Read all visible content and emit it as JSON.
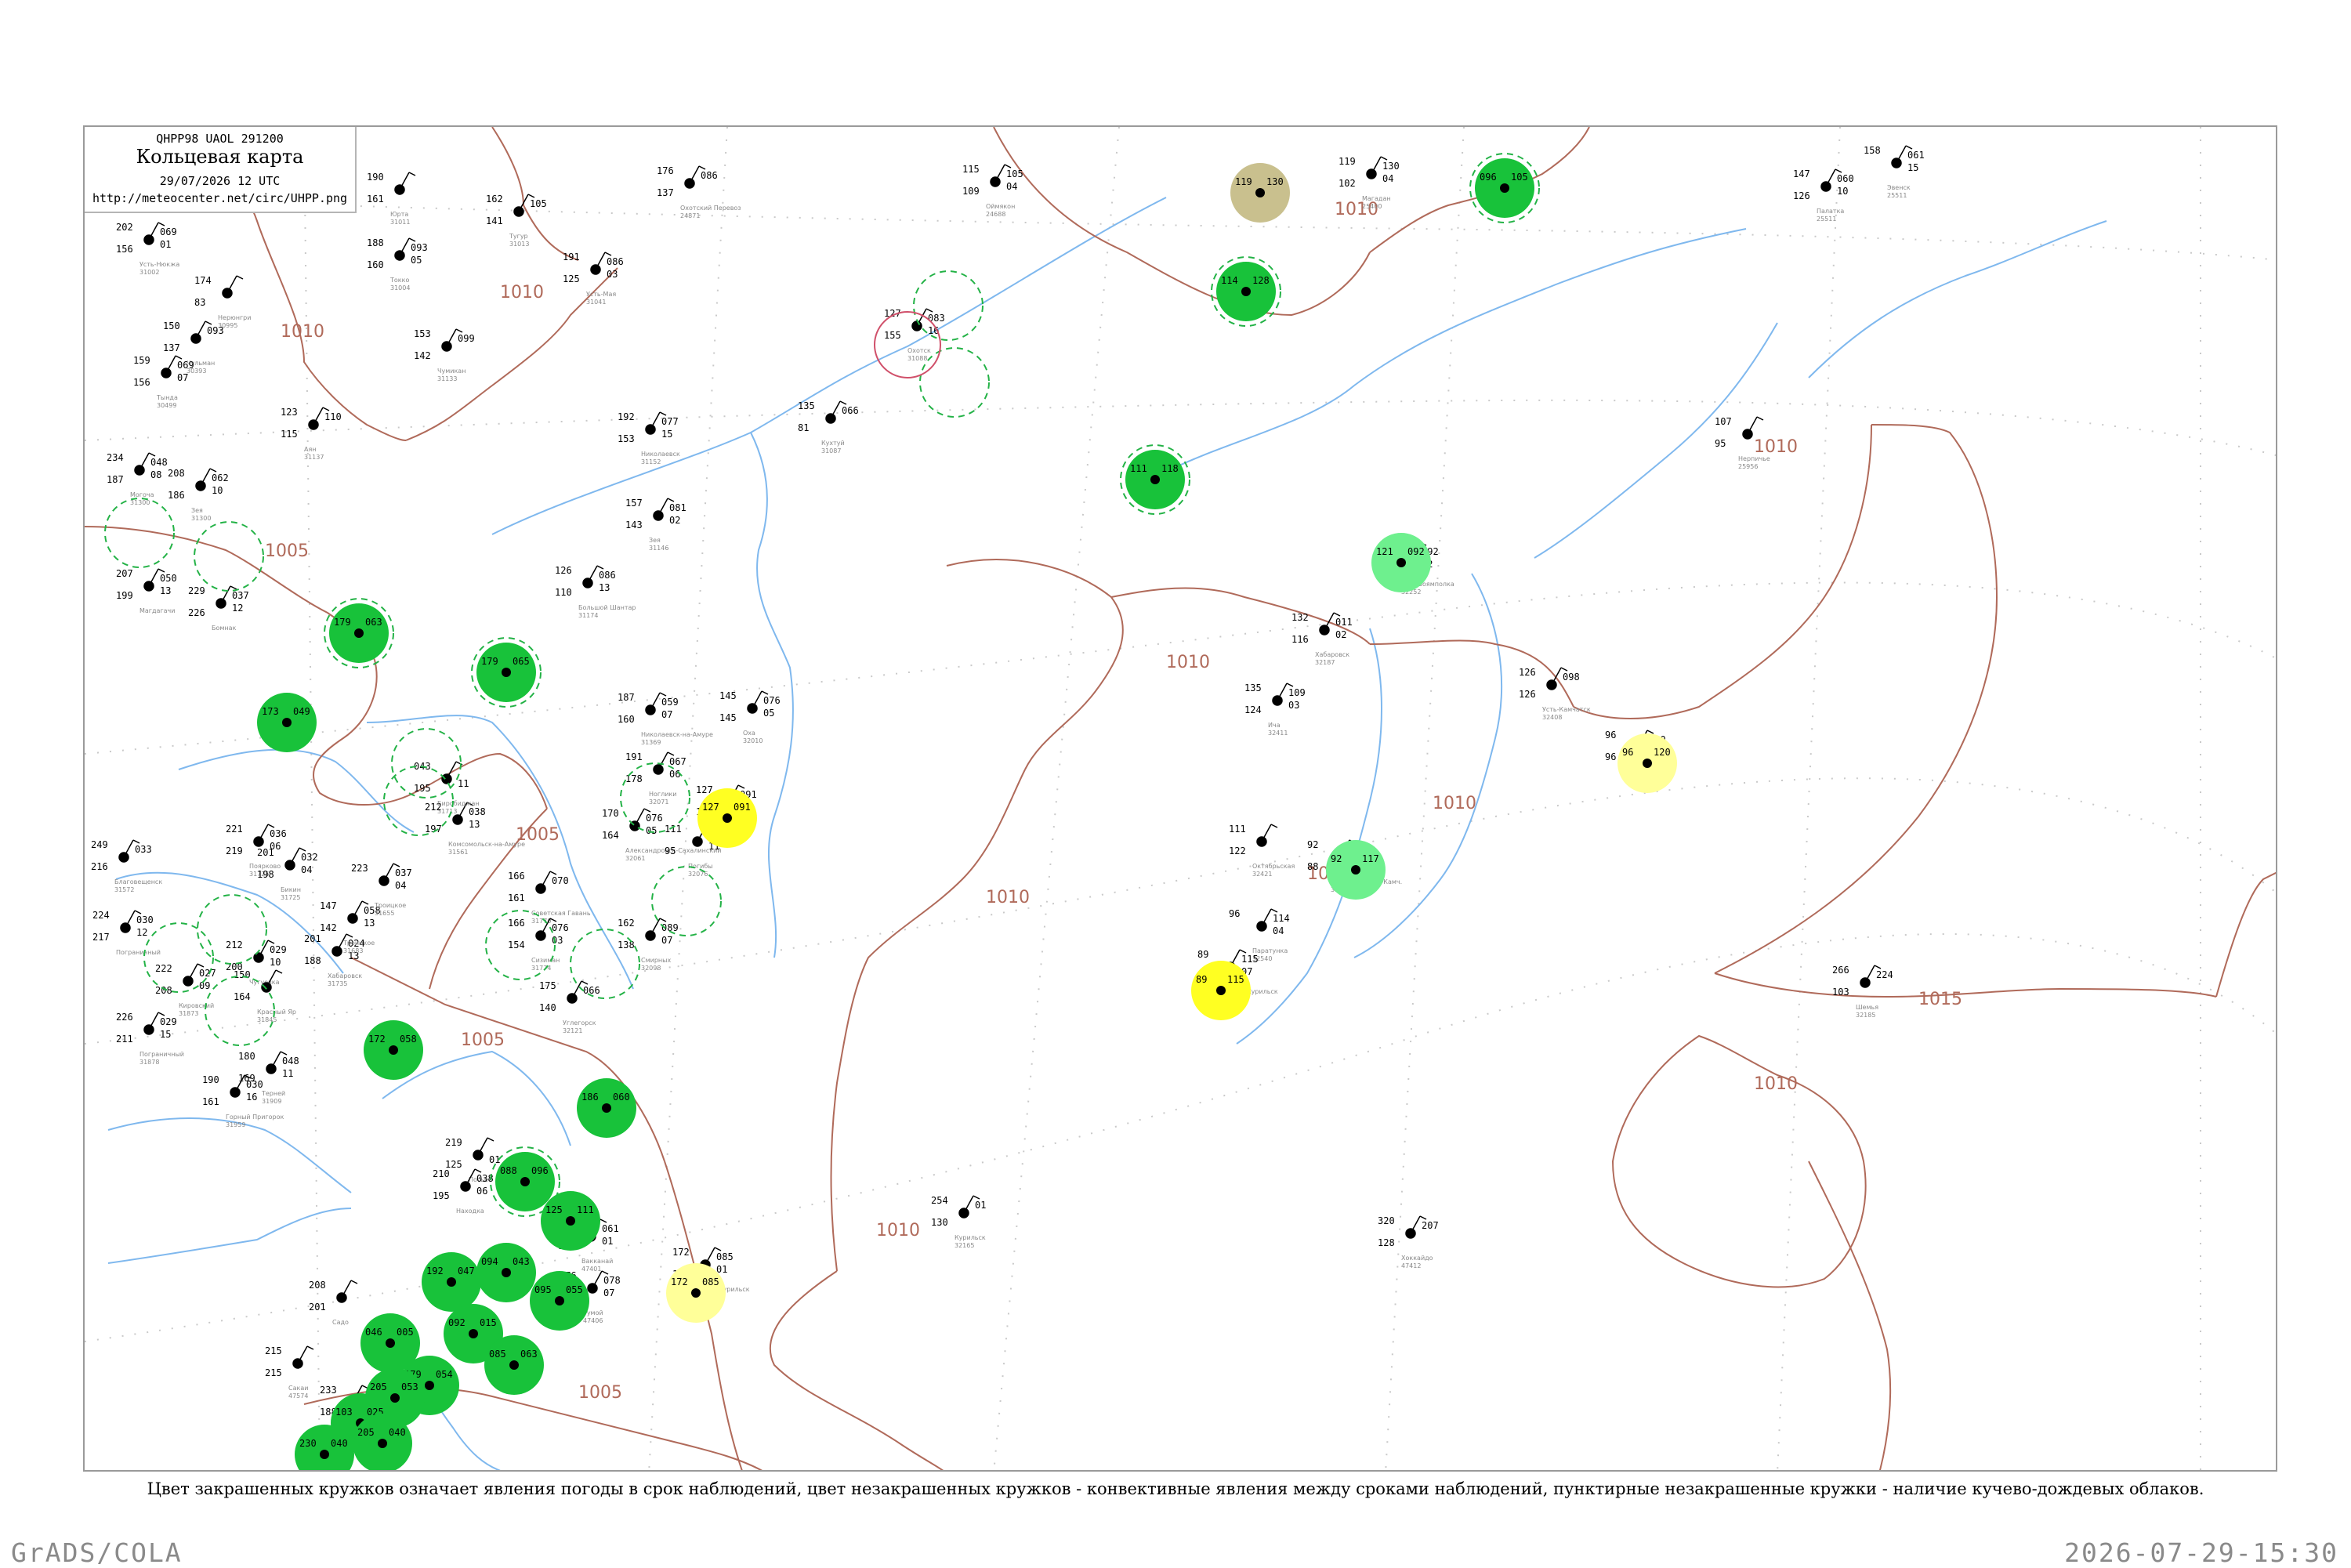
{
  "header": {
    "code": "QHPP98  UAOL  291200",
    "title": "Кольцевая карта",
    "time": "29/07/2026 12 UTC",
    "url": "http://meteocenter.net/circ/UHPP.png"
  },
  "caption": "Цвет закрашенных кружков означает явления погоды в срок наблюдений, цвет незакрашенных кружков - конвективные явления между сроками наблюдений, пунктирные незакрашенные кружки - наличие кучево-дождевых облаков.",
  "footer": {
    "left": "GrADS/COLA",
    "right": "2026-07-29-15:30"
  },
  "colors": {
    "isobar": "#b06a5a",
    "river": "#7fb8ee",
    "grid": "#c9c9c9",
    "green_fill": "#18c23a",
    "light_green_fill": "#6ef08e",
    "yellow_fill": "#ffff22",
    "pale_yellow_fill": "#ffff99",
    "olive_fill": "#c9c08e",
    "dashed_ring": "#23b246",
    "red_ring": "#d0506a"
  },
  "isobar_labels": [
    "1010",
    "1010",
    "1005",
    "1005",
    "1010",
    "1010",
    "1010",
    "1010",
    "1010",
    "1010",
    "1010",
    "1015",
    "1010",
    "1005",
    "1005"
  ],
  "stations": [
    {
      "id": "s1",
      "t": "202",
      "p": "156",
      "d": "069",
      "sub": "01",
      "name": "Усть-Нюкжа",
      "idx": "31002",
      "marker": "dot"
    },
    {
      "id": "s2",
      "t": "190",
      "p": "161",
      "d": "",
      "sub": "",
      "name": "Юрта",
      "idx": "31011",
      "marker": "dot"
    },
    {
      "id": "s3",
      "t": "162",
      "p": "141",
      "d": "105",
      "sub": "",
      "name": "Тугур",
      "idx": "31013",
      "marker": "dot"
    },
    {
      "id": "s4",
      "t": "174",
      "p": "83",
      "d": "",
      "sub": "",
      "name": "Нерюнгри",
      "idx": "30995",
      "marker": "dot"
    },
    {
      "id": "s5",
      "t": "150",
      "p": "137",
      "d": "093",
      "sub": "",
      "name": "Чульман",
      "idx": "30393",
      "marker": "dot"
    },
    {
      "id": "s6",
      "t": "159",
      "p": "156",
      "d": "069",
      "sub": "07",
      "name": "Тында",
      "idx": "30499",
      "marker": "dot"
    },
    {
      "id": "s7",
      "t": "188",
      "p": "160",
      "d": "093",
      "sub": "05",
      "name": "Токко",
      "idx": "31004",
      "marker": "dot"
    },
    {
      "id": "s8",
      "t": "191",
      "p": "125",
      "d": "086",
      "sub": "03",
      "name": "Усть-Мая",
      "idx": "31041",
      "marker": "dot"
    },
    {
      "id": "s9",
      "t": "176",
      "p": "137",
      "d": "086",
      "sub": "",
      "name": "Охотский Перевоз",
      "idx": "24871",
      "marker": "dot"
    },
    {
      "id": "s10",
      "t": "115",
      "p": "109",
      "d": "105",
      "sub": "04",
      "name": "Оймякон",
      "idx": "24688",
      "marker": "dot"
    },
    {
      "id": "s11",
      "t": "119",
      "p": "102",
      "d": "130",
      "sub": "04",
      "name": "Магадан",
      "idx": "25400",
      "marker": "dot"
    },
    {
      "id": "s12",
      "t": "147",
      "p": "126",
      "d": "060",
      "sub": "10",
      "name": "Палатка",
      "idx": "25511",
      "marker": "dot"
    },
    {
      "id": "s13",
      "t": "158",
      "p": "",
      "d": "061",
      "sub": "15",
      "name": "Эвенск",
      "idx": "25511",
      "marker": "dot"
    },
    {
      "id": "s14",
      "t": "153",
      "p": "142",
      "d": "099",
      "sub": "",
      "name": "Чумикан",
      "idx": "31133",
      "marker": "dot"
    },
    {
      "id": "s15",
      "t": "123",
      "p": "115",
      "d": "110",
      "sub": "",
      "name": "Аян",
      "idx": "31137",
      "marker": "dot"
    },
    {
      "id": "s16",
      "t": "192",
      "p": "153",
      "d": "077",
      "sub": "15",
      "name": "Николаевск",
      "idx": "31152",
      "marker": "dot"
    },
    {
      "id": "s17",
      "t": "127",
      "p": "155",
      "d": "083",
      "sub": "16",
      "name": "Охотск",
      "idx": "31088",
      "marker": "dot"
    },
    {
      "id": "s18",
      "t": "135",
      "p": "81",
      "d": "066",
      "sub": "",
      "name": "Кухтуй",
      "idx": "31087",
      "marker": "dot"
    },
    {
      "id": "s19",
      "t": "234",
      "p": "187",
      "d": "048",
      "sub": "08",
      "name": "Могоча",
      "idx": "31300",
      "marker": "dot"
    },
    {
      "id": "s20",
      "t": "208",
      "p": "186",
      "d": "062",
      "sub": "10",
      "name": "Зея",
      "idx": "31300",
      "marker": "dot"
    },
    {
      "id": "s21",
      "t": "157",
      "p": "143",
      "d": "081",
      "sub": "02",
      "name": "Зея",
      "idx": "31146",
      "marker": "dot"
    },
    {
      "id": "s22",
      "t": "126",
      "p": "110",
      "d": "086",
      "sub": "13",
      "name": "Большой Шантар",
      "idx": "31174",
      "marker": "dot"
    },
    {
      "id": "s23",
      "t": "207",
      "p": "199",
      "d": "050",
      "sub": "13",
      "name": "Магдагачи",
      "idx": "",
      "marker": "dot"
    },
    {
      "id": "s24",
      "t": "229",
      "p": "226",
      "d": "037",
      "sub": "12",
      "name": "Бомнак",
      "idx": "",
      "marker": "dot"
    },
    {
      "id": "s25",
      "t": "132",
      "p": "116",
      "d": "011",
      "sub": "02",
      "name": "Хабаровск",
      "idx": "32187",
      "marker": "dot"
    },
    {
      "id": "s26",
      "t": "121",
      "p": "122",
      "d": "092",
      "sub": "02",
      "name": "Усть-Воямполка",
      "idx": "32252",
      "marker": "dot"
    },
    {
      "id": "s27",
      "t": "135",
      "p": "124",
      "d": "109",
      "sub": "03",
      "name": "Ича",
      "idx": "32411",
      "marker": "dot"
    },
    {
      "id": "s28",
      "t": "126",
      "p": "126",
      "d": "098",
      "sub": "",
      "name": "Усть-Камчатск",
      "idx": "32408",
      "marker": "dot"
    },
    {
      "id": "s29",
      "t": "96",
      "p": "96",
      "d": "120",
      "sub": "05",
      "name": "Никольское",
      "idx": "32618",
      "marker": "dot"
    },
    {
      "id": "s30",
      "t": "92",
      "p": "88",
      "d": "117",
      "sub": "02",
      "name": "Петропавловск-Камч.",
      "idx": "32583",
      "marker": "dot"
    },
    {
      "id": "s31",
      "t": "96",
      "p": "",
      "d": "114",
      "sub": "04",
      "name": "Паратунка",
      "idx": "32540",
      "marker": "dot"
    },
    {
      "id": "s32",
      "t": "111",
      "p": "122",
      "d": "",
      "sub": "",
      "name": "Октябрьская",
      "idx": "32421",
      "marker": "dot"
    },
    {
      "id": "s33",
      "t": "89",
      "p": "89",
      "d": "115",
      "sub": "07",
      "name": "Северо-Курильск",
      "idx": "32215",
      "marker": "dot"
    },
    {
      "id": "s34",
      "t": "107",
      "p": "95",
      "d": "",
      "sub": "",
      "name": "Нерпичье",
      "idx": "25956",
      "marker": "dot"
    },
    {
      "id": "s35",
      "t": "266",
      "p": "103",
      "d": "224",
      "sub": "",
      "name": "Шемья",
      "idx": "32185",
      "marker": "dot"
    },
    {
      "id": "s36",
      "t": "254",
      "p": "130",
      "d": "01",
      "sub": "",
      "name": "Курильск",
      "idx": "32165",
      "marker": "dot"
    },
    {
      "id": "s37",
      "t": "320",
      "p": "128",
      "d": "207",
      "sub": "",
      "name": "Хоккайдо",
      "idx": "47412",
      "marker": "dot"
    },
    {
      "id": "s38",
      "t": "172",
      "p": "172",
      "d": "085",
      "sub": "01",
      "name": "Южно-Курильск",
      "idx": "32165",
      "marker": "dot"
    },
    {
      "id": "s39",
      "t": "127",
      "p": "127",
      "d": "091",
      "sub": "05",
      "name": "Поронайск",
      "idx": "32053",
      "marker": "dot"
    },
    {
      "id": "s40",
      "t": "145",
      "p": "145",
      "d": "076",
      "sub": "05",
      "name": "Оха",
      "idx": "32010",
      "marker": "dot"
    },
    {
      "id": "s41",
      "t": "187",
      "p": "160",
      "d": "059",
      "sub": "07",
      "name": "Николаевск-на-Амуре",
      "idx": "31369",
      "marker": "dot"
    },
    {
      "id": "s42",
      "t": "191",
      "p": "178",
      "d": "067",
      "sub": "06",
      "name": "Ноглики",
      "idx": "32071",
      "marker": "dot"
    },
    {
      "id": "s43",
      "t": "170",
      "p": "164",
      "d": "076",
      "sub": "05",
      "name": "Александровск-Сахалинский",
      "idx": "32061",
      "marker": "dot"
    },
    {
      "id": "s44",
      "t": "111",
      "p": "95",
      "d": "090",
      "sub": "11",
      "name": "Погибы",
      "idx": "32076",
      "marker": "dot"
    },
    {
      "id": "s45",
      "t": "162",
      "p": "138",
      "d": "089",
      "sub": "07",
      "name": "Смирных",
      "idx": "32098",
      "marker": "dot"
    },
    {
      "id": "s46",
      "t": "175",
      "p": "140",
      "d": "066",
      "sub": "",
      "name": "Углегорск",
      "idx": "32121",
      "marker": "dot"
    },
    {
      "id": "s47",
      "t": "166",
      "p": "161",
      "d": "070",
      "sub": "",
      "name": "Советская Гавань",
      "idx": "31770",
      "marker": "dot"
    },
    {
      "id": "s48",
      "t": "166",
      "p": "154",
      "d": "076",
      "sub": "03",
      "name": "Сизиман",
      "idx": "31774",
      "marker": "dot"
    },
    {
      "id": "s49",
      "t": "221",
      "p": "219",
      "d": "036",
      "sub": "06",
      "name": "Поярково",
      "idx": "31725",
      "marker": "dot"
    },
    {
      "id": "s50",
      "t": "201",
      "p": "198",
      "d": "032",
      "sub": "04",
      "name": "Бикин",
      "idx": "31725",
      "marker": "dot"
    },
    {
      "id": "s51",
      "t": "249",
      "p": "216",
      "d": "033",
      "sub": "",
      "name": "Благовещенск",
      "idx": "31572",
      "marker": "dot"
    },
    {
      "id": "s52",
      "t": "224",
      "p": "217",
      "d": "030",
      "sub": "12",
      "name": "Пограничный",
      "idx": "",
      "marker": "dot"
    },
    {
      "id": "s53",
      "t": "212",
      "p": "200",
      "d": "029",
      "sub": "10",
      "name": "Чугуевка",
      "idx": "",
      "marker": "dot"
    },
    {
      "id": "s54",
      "t": "222",
      "p": "208",
      "d": "027",
      "sub": "09",
      "name": "Кировский",
      "idx": "31873",
      "marker": "dot"
    },
    {
      "id": "s55",
      "t": "150",
      "p": "164",
      "d": "",
      "sub": "",
      "name": "Красный Яр",
      "idx": "31845",
      "marker": "dot"
    },
    {
      "id": "s56",
      "t": "226",
      "p": "211",
      "d": "029",
      "sub": "15",
      "name": "Пограничный",
      "idx": "31878",
      "marker": "dot"
    },
    {
      "id": "s57",
      "t": "180",
      "p": "169",
      "d": "048",
      "sub": "11",
      "name": "Терней",
      "idx": "31909",
      "marker": "dot"
    },
    {
      "id": "s58",
      "t": "190",
      "p": "161",
      "d": "030",
      "sub": "16",
      "name": "Горный Пригорок",
      "idx": "31959",
      "marker": "dot"
    },
    {
      "id": "s59",
      "t": "201",
      "p": "188",
      "d": "024",
      "sub": "13",
      "name": "Хабаровск",
      "idx": "31735",
      "marker": "dot"
    },
    {
      "id": "s60",
      "t": "147",
      "p": "142",
      "d": "058",
      "sub": "13",
      "name": "Троицкое",
      "idx": "31683",
      "marker": "dot"
    },
    {
      "id": "s61",
      "t": "223",
      "p": "",
      "d": "037",
      "sub": "04",
      "name": "Троицкое",
      "idx": "31655",
      "marker": "dot"
    },
    {
      "id": "s62",
      "t": "212",
      "p": "197",
      "d": "038",
      "sub": "13",
      "name": "Комсомольск-на-Амуре",
      "idx": "31561",
      "marker": "dot"
    },
    {
      "id": "s63",
      "t": "219",
      "p": "125",
      "d": "",
      "sub": "01",
      "name": "Посьет",
      "idx": "",
      "marker": "dot"
    },
    {
      "id": "s64",
      "t": "210",
      "p": "195",
      "d": "038",
      "sub": "06",
      "name": "Находка",
      "idx": "",
      "marker": "dot"
    },
    {
      "id": "s65",
      "t": "209",
      "p": "163",
      "d": "061",
      "sub": "01",
      "name": "Вакканай",
      "idx": "47401",
      "marker": "dot"
    },
    {
      "id": "s66",
      "t": "176",
      "p": "167",
      "d": "078",
      "sub": "07",
      "name": "Румой",
      "idx": "47406",
      "marker": "dot"
    },
    {
      "id": "s67",
      "t": "215",
      "p": "215",
      "d": "",
      "sub": "",
      "name": "Сакаи",
      "idx": "47574",
      "marker": "dot"
    },
    {
      "id": "s68",
      "t": "233",
      "p": "188",
      "d": "",
      "sub": "",
      "name": "Ниигата",
      "idx": "47604",
      "marker": "dot"
    },
    {
      "id": "s69",
      "t": "208",
      "p": "201",
      "d": "",
      "sub": "",
      "name": "Садо",
      "idx": "",
      "marker": "dot"
    },
    {
      "id": "s70",
      "t": "043",
      "p": "195",
      "d": "",
      "sub": "11",
      "name": "Биробиджан",
      "idx": "31713",
      "marker": "dot"
    }
  ],
  "circles": [
    {
      "id": "g1",
      "kind": "filled",
      "color": "green",
      "label_t": "096",
      "label_p": "105"
    },
    {
      "id": "g2",
      "kind": "filled",
      "color": "green",
      "label_t": "114",
      "label_p": "128"
    },
    {
      "id": "g3",
      "kind": "filled",
      "color": "green",
      "label_t": "111",
      "label_p": "118"
    },
    {
      "id": "g4",
      "kind": "filled",
      "color": "green",
      "label_t": "179",
      "label_p": "063"
    },
    {
      "id": "g5",
      "kind": "filled",
      "color": "green",
      "label_t": "179",
      "label_p": "065"
    },
    {
      "id": "g6",
      "kind": "filled",
      "color": "green",
      "label_t": "173",
      "label_p": "049"
    },
    {
      "id": "g7",
      "kind": "filled",
      "color": "green",
      "label_t": "172",
      "label_p": "058"
    },
    {
      "id": "g8",
      "kind": "filled",
      "color": "green",
      "label_t": "186",
      "label_p": "060"
    },
    {
      "id": "g9",
      "kind": "filled",
      "color": "green",
      "label_t": "088",
      "label_p": "096"
    },
    {
      "id": "g10",
      "kind": "filled",
      "color": "green",
      "label_t": "125",
      "label_p": "111"
    },
    {
      "id": "g11",
      "kind": "filled",
      "color": "green",
      "label_t": "094",
      "label_p": "043"
    },
    {
      "id": "g12",
      "kind": "filled",
      "color": "green",
      "label_t": "095",
      "label_p": "055"
    },
    {
      "id": "g13",
      "kind": "filled",
      "color": "green",
      "label_t": "192",
      "label_p": "047"
    },
    {
      "id": "g14",
      "kind": "filled",
      "color": "green",
      "label_t": "092",
      "label_p": "015"
    },
    {
      "id": "g15",
      "kind": "filled",
      "color": "green",
      "label_t": "046",
      "label_p": "005"
    },
    {
      "id": "g16",
      "kind": "filled",
      "color": "green",
      "label_t": "085",
      "label_p": "063"
    },
    {
      "id": "g17",
      "kind": "filled",
      "color": "green",
      "label_t": "179",
      "label_p": "054"
    },
    {
      "id": "g18",
      "kind": "filled",
      "color": "green",
      "label_t": "205",
      "label_p": "053"
    },
    {
      "id": "g19",
      "kind": "filled",
      "color": "green",
      "label_t": "103",
      "label_p": "025"
    },
    {
      "id": "g20",
      "kind": "filled",
      "color": "green",
      "label_t": "205",
      "label_p": "040"
    },
    {
      "id": "g21",
      "kind": "filled",
      "color": "green",
      "label_t": "230",
      "label_p": "040"
    },
    {
      "id": "lg1",
      "kind": "filled",
      "color": "light_green",
      "label_t": "121",
      "label_p": "092"
    },
    {
      "id": "lg2",
      "kind": "filled",
      "color": "light_green",
      "label_t": "92",
      "label_p": "117"
    },
    {
      "id": "y1",
      "kind": "filled",
      "color": "yellow",
      "label_t": "127",
      "label_p": "091"
    },
    {
      "id": "y2",
      "kind": "filled",
      "color": "yellow",
      "label_t": "89",
      "label_p": "115"
    },
    {
      "id": "py1",
      "kind": "filled",
      "color": "pale_yellow",
      "label_t": "96",
      "label_p": "120"
    },
    {
      "id": "py2",
      "kind": "filled",
      "color": "pale_yellow",
      "label_t": "172",
      "label_p": "085"
    },
    {
      "id": "o1",
      "kind": "filled",
      "color": "olive",
      "label_t": "119",
      "label_p": "130"
    }
  ]
}
